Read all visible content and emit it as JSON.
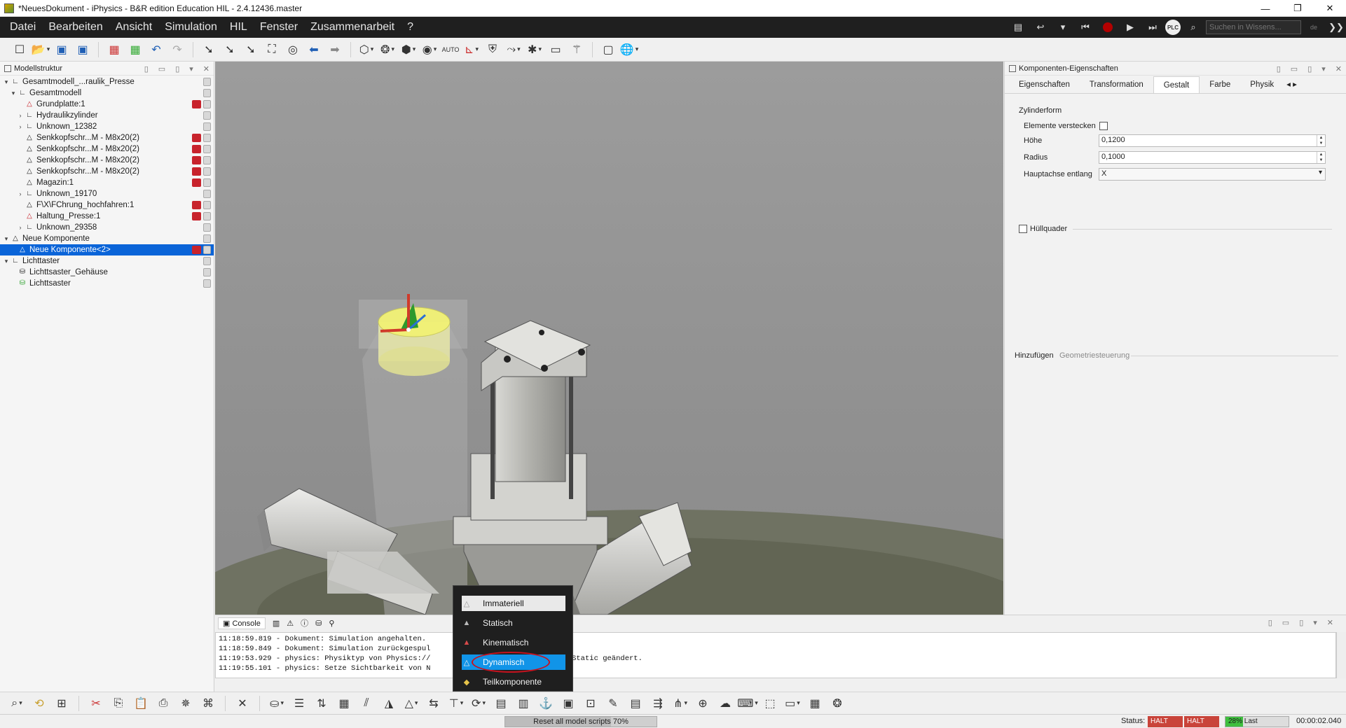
{
  "window": {
    "title": "*NeuesDokument - iPhysics - B&R edition Education HIL - 2.4.12436.master",
    "controls": [
      "—",
      "❐",
      "✕"
    ]
  },
  "menu": {
    "items": [
      "Datei",
      "Bearbeiten",
      "Ansicht",
      "Simulation",
      "HIL",
      "Fenster",
      "Zusammenarbeit",
      "?"
    ],
    "search_placeholder": "Suchen in Wissens...",
    "plc_label": "PLC"
  },
  "left_panel": {
    "title": "Modellstruktur",
    "tree": [
      {
        "label": "Gesamtmodell_...raulik_Presse",
        "level": 0,
        "exp": "▾",
        "icon": "∟"
      },
      {
        "label": "Gesamtmodell",
        "level": 1,
        "exp": "▾",
        "icon": "∟"
      },
      {
        "label": "Grundplatte:1",
        "level": 2,
        "exp": "",
        "icon": "△",
        "red": true
      },
      {
        "label": "Hydraulikzylinder",
        "level": 2,
        "exp": "›",
        "icon": "∟"
      },
      {
        "label": "Unknown_12382",
        "level": 2,
        "exp": "›",
        "icon": "∟"
      },
      {
        "label": "Senkkopfschr...M - M8x20(2)",
        "level": 2,
        "exp": "",
        "icon": "△"
      },
      {
        "label": "Senkkopfschr...M - M8x20(2)",
        "level": 2,
        "exp": "",
        "icon": "△"
      },
      {
        "label": "Senkkopfschr...M - M8x20(2)",
        "level": 2,
        "exp": "",
        "icon": "△"
      },
      {
        "label": "Senkkopfschr...M - M8x20(2)",
        "level": 2,
        "exp": "",
        "icon": "△"
      },
      {
        "label": "Magazin:1",
        "level": 2,
        "exp": "",
        "icon": "△"
      },
      {
        "label": "Unknown_19170",
        "level": 2,
        "exp": "›",
        "icon": "∟"
      },
      {
        "label": "F\\X\\FChrung_hochfahren:1",
        "level": 2,
        "exp": "",
        "icon": "△"
      },
      {
        "label": "Haltung_Presse:1",
        "level": 2,
        "exp": "",
        "icon": "△",
        "red": true
      },
      {
        "label": "Unknown_29358",
        "level": 2,
        "exp": "›",
        "icon": "∟"
      },
      {
        "label": "Neue Komponente",
        "level": 0,
        "exp": "▾",
        "icon": "△"
      },
      {
        "label": "Neue Komponente<2>",
        "level": 1,
        "exp": "",
        "icon": "△",
        "selected": true
      },
      {
        "label": "Lichttaster",
        "level": 0,
        "exp": "▾",
        "icon": "∟"
      },
      {
        "label": "Lichttsaster_Gehäuse",
        "level": 1,
        "exp": "",
        "icon": "⛁"
      },
      {
        "label": "Lichttsaster",
        "level": 1,
        "exp": "",
        "icon": "⛁",
        "green": true
      }
    ]
  },
  "right_panel": {
    "title": "Komponenten-Eigenschaften",
    "tabs": [
      "Eigenschaften",
      "Transformation",
      "Gestalt",
      "Farbe",
      "Physik"
    ],
    "active_tab": "Gestalt",
    "group_title": "Zylinderform",
    "fields": {
      "hide_label": "Elemente verstecken",
      "height_label": "Höhe",
      "height_value": "0,1200",
      "radius_label": "Radius",
      "radius_value": "0,1000",
      "axis_label": "Hauptachse entlang",
      "axis_value": "X"
    },
    "bbox_label": "Hüllquader",
    "add_label": "Hinzufügen",
    "geom_label": "Geometriesteuerung"
  },
  "console": {
    "tab": "Console",
    "lines": [
      "11:18:59.819 - Dokument: Simulation angehalten.",
      "11:18:59.849 - Dokument: Simulation zurückgespul",
      "11:19:53.929 - physics: Physiktyp von Physics://                            auf Static geändert.",
      "11:19:55.101 - physics: Setze Sichtbarkeit von N"
    ]
  },
  "context_menu": {
    "items": [
      "Immateriell",
      "Statisch",
      "Kinematisch",
      "Dynamisch",
      "Teilkomponente"
    ],
    "highlighted": "Immateriell",
    "selected": "Dynamisch"
  },
  "status": {
    "progress_text": "Reset all model scripts 70%",
    "progress": 0.7,
    "status_label": "Status:",
    "halt1": "HALT",
    "halt2": "HALT",
    "load_text": "28% Last",
    "load": 0.28,
    "clock": "00:00:02.040"
  },
  "colors": {
    "menubar": "#1f1f1f",
    "selection": "#0a64d8",
    "menu_selected": "#1194e8",
    "halt": "#c9443a",
    "load": "#3fbf3f"
  }
}
